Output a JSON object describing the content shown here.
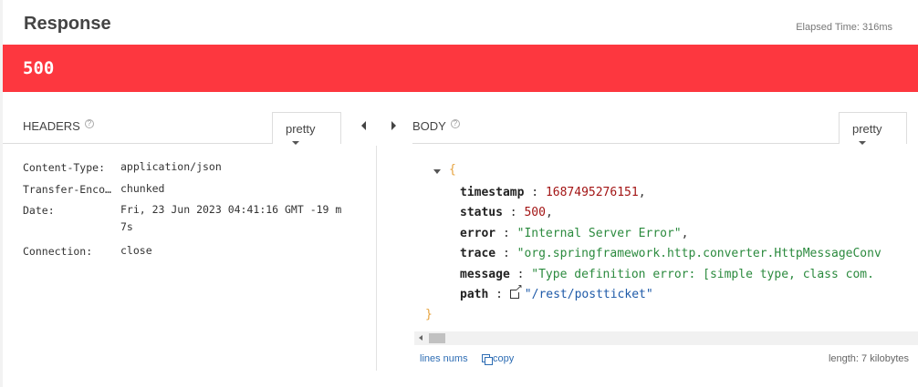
{
  "header": {
    "title": "Response",
    "elapsed": "Elapsed Time: 316ms"
  },
  "status": {
    "code": "500",
    "color": "#fd373f"
  },
  "headers_panel": {
    "label": "HEADERS",
    "help": "?",
    "format": "pretty",
    "rows": [
      {
        "key": "Content-Type:",
        "value": "application/json"
      },
      {
        "key": "Transfer-Enco…",
        "value": "chunked"
      },
      {
        "key": "Date:",
        "value": "Fri, 23 Jun 2023 04:41:16 GMT -19 m 7s"
      },
      {
        "key": "Connection:",
        "value": "close"
      }
    ]
  },
  "body_panel": {
    "label": "BODY",
    "help": "?",
    "format": "pretty",
    "open_brace": "{",
    "close_brace": "}",
    "fields": [
      {
        "key": "timestamp",
        "sep": " : ",
        "value": "1687495276151",
        "suffix": ","
      },
      {
        "key": "status",
        "sep": " : ",
        "value": "500",
        "suffix": ","
      },
      {
        "key": "error",
        "sep": " : ",
        "value": "\"Internal Server Error\"",
        "suffix": ","
      },
      {
        "key": "trace",
        "sep": " : ",
        "value": "\"org.springframework.http.converter.HttpMessageConv",
        "suffix": ""
      },
      {
        "key": "message",
        "sep": " : ",
        "value": "\"Type definition error: [simple type, class com.",
        "suffix": ""
      },
      {
        "key": "path",
        "sep": " : ",
        "value": "\"/rest/postticket\"",
        "suffix": ""
      }
    ],
    "footer": {
      "line_nums": "lines nums",
      "copy": "copy",
      "length": "length: 7 kilobytes"
    }
  }
}
